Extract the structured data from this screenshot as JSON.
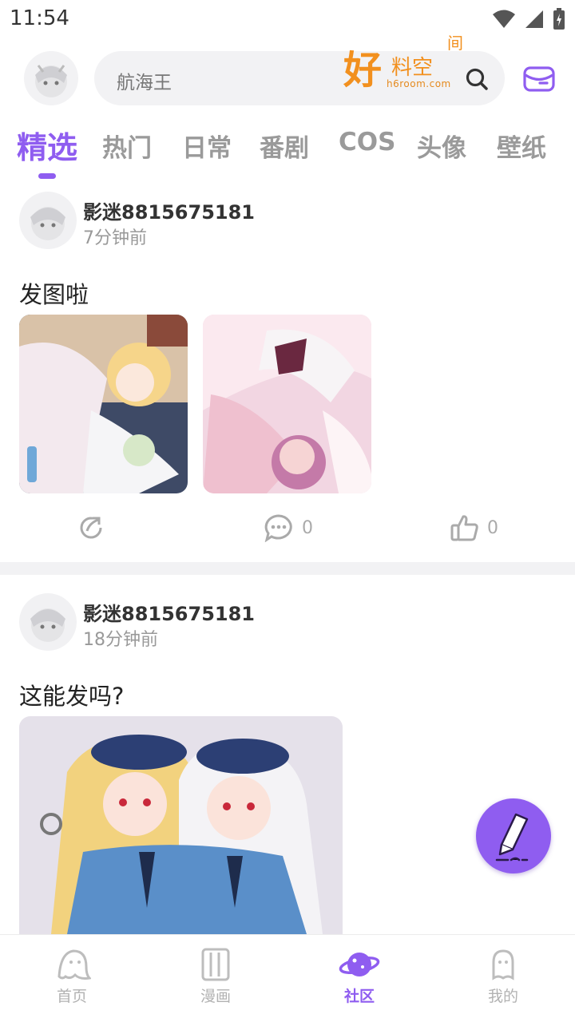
{
  "status_bar": {
    "time": "11:54"
  },
  "header": {
    "search_placeholder": "航海王",
    "logo": {
      "main": "好",
      "small": "料空",
      "side": "间",
      "url": "h6room.com"
    }
  },
  "tabs": [
    {
      "label": "精选",
      "active": true
    },
    {
      "label": "热门"
    },
    {
      "label": "日常"
    },
    {
      "label": "番剧"
    },
    {
      "label": "COS"
    },
    {
      "label": "头像"
    },
    {
      "label": "壁纸"
    }
  ],
  "posts": [
    {
      "author": "影迷8815675181",
      "time": "7分钟前",
      "text": "发图啦",
      "comments": "0",
      "likes": "0"
    },
    {
      "author": "影迷8815675181",
      "time": "18分钟前",
      "text": "这能发吗?"
    }
  ],
  "bottom_nav": [
    {
      "label": "首页"
    },
    {
      "label": "漫画"
    },
    {
      "label": "社区",
      "active": true
    },
    {
      "label": "我的"
    }
  ],
  "colors": {
    "accent": "#8f5df0",
    "logo": "#f2901e",
    "muted": "#9a9a9a"
  }
}
